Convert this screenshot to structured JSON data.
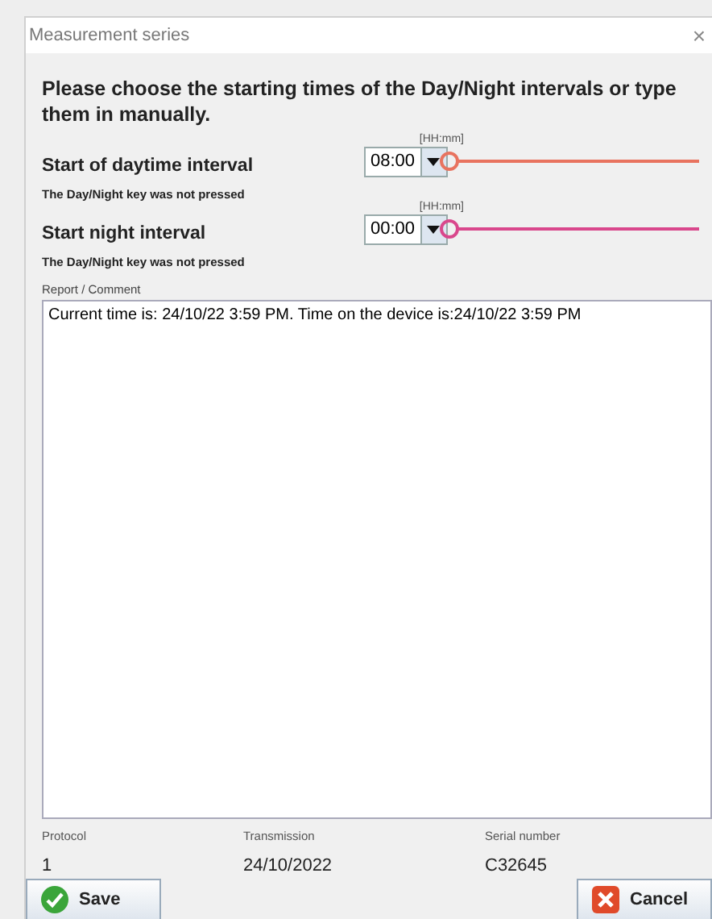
{
  "window": {
    "title": "Measurement series",
    "close": "×"
  },
  "instruction": "Please choose the starting times of the Day/Night intervals or type them in manually.",
  "intervals": [
    {
      "hint": "[HH:mm]",
      "label": "Start of daytime interval",
      "value": "08:00",
      "note": "The Day/Night key was not pressed",
      "color": "#e8735f"
    },
    {
      "hint": "[HH:mm]",
      "label": "Start night interval",
      "value": "00:00",
      "note": "The Day/Night key was not pressed",
      "color": "#d9478c"
    }
  ],
  "report": {
    "label": "Report / Comment",
    "value": "Current time is:  24/10/22 3:59 PM. Time on the device is:24/10/22 3:59 PM"
  },
  "info": [
    {
      "label": "Protocol",
      "value": "1"
    },
    {
      "label": "Transmission",
      "value": "24/10/2022"
    },
    {
      "label": "Serial number",
      "value": "C32645"
    }
  ],
  "buttons": [
    {
      "kind": "save",
      "label": "Save"
    },
    {
      "kind": "cancel",
      "label": "Cancel"
    }
  ]
}
